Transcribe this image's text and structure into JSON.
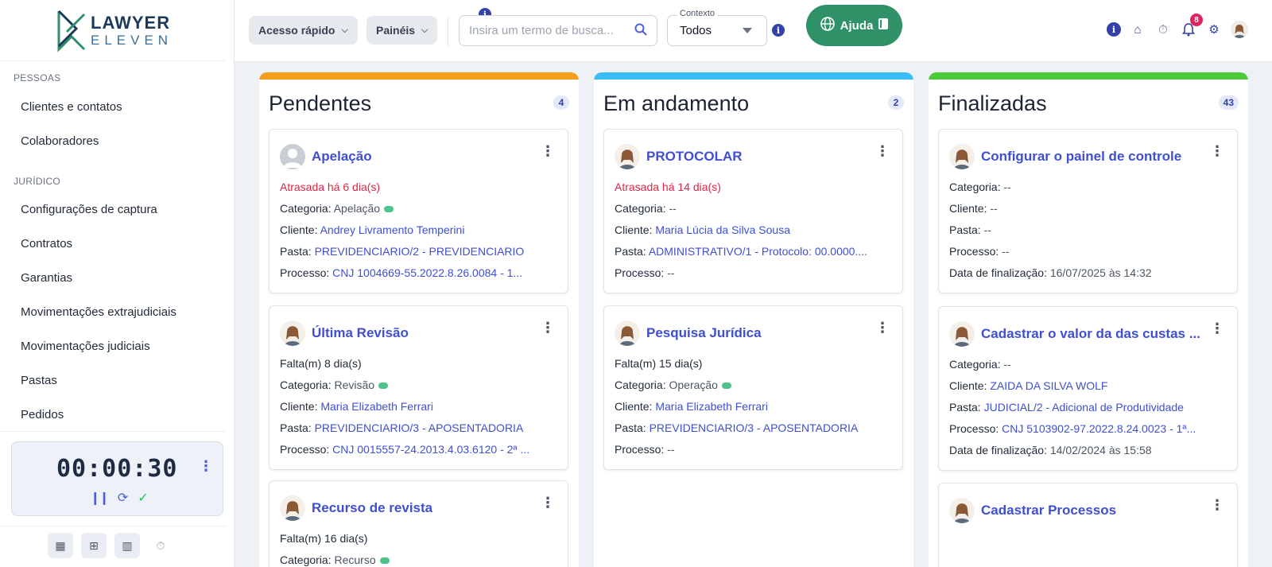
{
  "brand": {
    "line1": "LAWYER",
    "line2": "ELEVEN"
  },
  "sidebar": {
    "sections": [
      {
        "label": "PESSOAS",
        "items": [
          "Clientes e contatos",
          "Colaboradores"
        ]
      },
      {
        "label": "JURÍDICO",
        "items": [
          "Configurações de captura",
          "Contratos",
          "Garantias",
          "Movimentações extrajudiciais",
          "Movimentações judiciais",
          "Pastas",
          "Pedidos"
        ]
      }
    ],
    "timer": {
      "value": "00:00:30"
    }
  },
  "topbar": {
    "quick_access": "Acesso rápido",
    "panels": "Painéis",
    "search_placeholder": "Insira um termo de busca...",
    "context_label": "Contexto",
    "context_value": "Todos",
    "help_label": "Ajuda",
    "notification_count": "8"
  },
  "colors": {
    "pending": "#f59e1b",
    "in_progress": "#38bdf8",
    "done": "#4ccb3a",
    "accent": "#3f4fd0",
    "help": "#2e9167"
  },
  "columns": [
    {
      "title": "Pendentes",
      "count": "4",
      "cards": [
        {
          "title": "Apelação",
          "status": "Atrasada há 6 dia(s)",
          "lines": [
            {
              "label": "Categoria: ",
              "value": "Apelação",
              "dot": true
            },
            {
              "label": "Cliente: ",
              "value": "Andrey Livramento Temperini",
              "link": true
            },
            {
              "label": "Pasta: ",
              "value": "PREVIDENCIARIO/2 - PREVIDENCIARIO",
              "link": true
            },
            {
              "label": "Processo: ",
              "value": "CNJ 1004669-55.2022.8.26.0084 - 1...",
              "link": true
            }
          ]
        },
        {
          "title": "Última Revisão",
          "status": "Falta(m) 8 dia(s)",
          "lines": [
            {
              "label": "Categoria: ",
              "value": "Revisão",
              "dot": true
            },
            {
              "label": "Cliente: ",
              "value": "Maria Elizabeth Ferrari",
              "link": true
            },
            {
              "label": "Pasta: ",
              "value": "PREVIDENCIARIO/3 - APOSENTADORIA",
              "link": true
            },
            {
              "label": "Processo: ",
              "value": "CNJ 0015557-24.2013.4.03.6120 - 2ª ...",
              "link": true
            }
          ]
        },
        {
          "title": "Recurso de revista",
          "status": "Falta(m) 16 dia(s)",
          "lines": [
            {
              "label": "Categoria: ",
              "value": "Recurso",
              "dot": true
            }
          ]
        }
      ]
    },
    {
      "title": "Em andamento",
      "count": "2",
      "cards": [
        {
          "title": "PROTOCOLAR",
          "status": "Atrasada há 14 dia(s)",
          "lines": [
            {
              "label": "Categoria: ",
              "value": "--"
            },
            {
              "label": "Cliente: ",
              "value": "Maria Lúcia da Silva Sousa",
              "link": true
            },
            {
              "label": "Pasta: ",
              "value": "ADMINISTRATIVO/1 - Protocolo: 00.0000....",
              "link": true
            },
            {
              "label": "Processo: ",
              "value": "--"
            }
          ]
        },
        {
          "title": "Pesquisa Jurídica",
          "status": "Falta(m) 15 dia(s)",
          "lines": [
            {
              "label": "Categoria: ",
              "value": "Operação",
              "dot": true
            },
            {
              "label": "Cliente: ",
              "value": "Maria Elizabeth Ferrari",
              "link": true
            },
            {
              "label": "Pasta: ",
              "value": "PREVIDENCIARIO/3 - APOSENTADORIA",
              "link": true
            },
            {
              "label": "Processo: ",
              "value": "--"
            }
          ]
        }
      ]
    },
    {
      "title": "Finalizadas",
      "count": "43",
      "cards": [
        {
          "title": "Configurar o painel de controle",
          "status": "",
          "lines": [
            {
              "label": "Categoria: ",
              "value": "--"
            },
            {
              "label": "Cliente: ",
              "value": "--"
            },
            {
              "label": "Pasta: ",
              "value": "--"
            },
            {
              "label": "Processo: ",
              "value": "--"
            },
            {
              "label": "Data de finalização: ",
              "value": "16/07/2025 às 14:32"
            }
          ]
        },
        {
          "title": "Cadastrar o valor da das custas ...",
          "status": "",
          "lines": [
            {
              "label": "Categoria: ",
              "value": "--"
            },
            {
              "label": "Cliente: ",
              "value": "ZAIDA DA SILVA WOLF",
              "link": true
            },
            {
              "label": "Pasta: ",
              "value": "JUDICIAL/2 - Adicional de Produtividade",
              "link": true
            },
            {
              "label": "Processo: ",
              "value": "CNJ 5103902-97.2022.8.24.0023 - 1ª...",
              "link": true
            },
            {
              "label": "Data de finalização: ",
              "value": "14/02/2024 às 15:58"
            }
          ]
        },
        {
          "title": "Cadastrar Processos",
          "status": "",
          "lines": []
        }
      ]
    }
  ]
}
